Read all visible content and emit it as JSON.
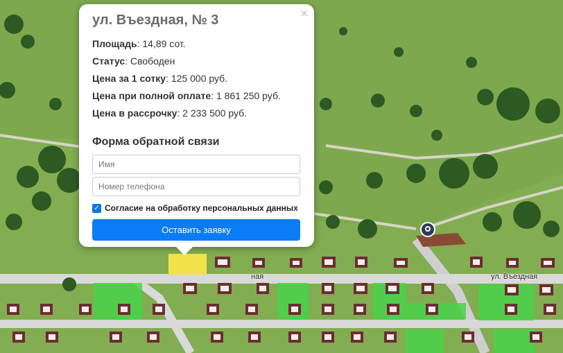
{
  "popup": {
    "title": "ул. Въездная, № 3",
    "close_icon": "×",
    "fields": [
      {
        "label": "Площадь",
        "value": ": 14,89 сот."
      },
      {
        "label": "Статус",
        "value": ": Свободен"
      },
      {
        "label": "Цена за 1 сотку",
        "value": ": 125 000 руб."
      },
      {
        "label": "Цена при полной оплате",
        "value": ": 1 861 250 руб."
      },
      {
        "label": "Цена в рассрочку",
        "value": ": 2 233 500 руб."
      }
    ],
    "form_title": "Форма обратной связи",
    "name_placeholder": "Имя",
    "phone_placeholder": "Номер телефона",
    "consent_label": "Согласие на обработку персональных данных",
    "consent_checked": true,
    "submit_label": "Оставить заявку"
  },
  "map": {
    "street_label": "ул. Въездная",
    "street_label_partial": "ная",
    "colors": {
      "grass": "#7aa64a",
      "road": "#d8d8d8",
      "selected_plot": "#f4e24a",
      "free_plot": "#49d24a",
      "roof": "#6b2d33",
      "tree": "#2f5a22"
    }
  }
}
